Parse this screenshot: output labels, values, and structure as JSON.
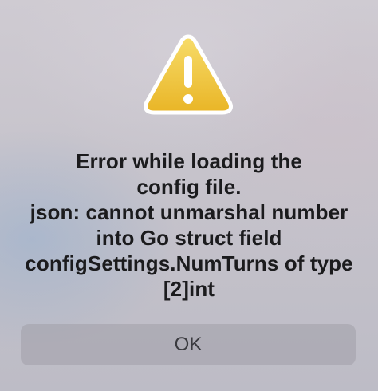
{
  "alert": {
    "icon": "warning-triangle-icon",
    "icon_color": "#f0c83a",
    "message_lines": [
      "Error while loading the",
      "config file.",
      "json: cannot unmarshal number",
      "into Go struct field",
      "configSettings.NumTurns of type",
      "[2]int"
    ],
    "ok_label": "OK"
  }
}
